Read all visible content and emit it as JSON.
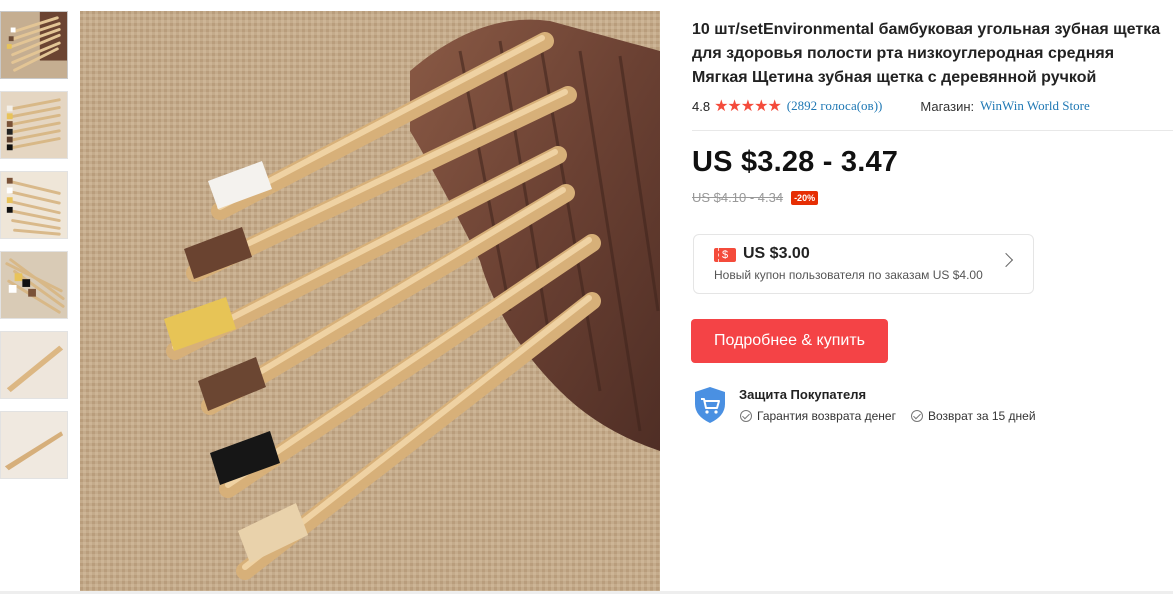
{
  "thumbnails": [
    {
      "name": "thumbnail-1",
      "active": true
    },
    {
      "name": "thumbnail-2"
    },
    {
      "name": "thumbnail-3"
    },
    {
      "name": "thumbnail-4"
    },
    {
      "name": "thumbnail-5"
    },
    {
      "name": "thumbnail-6"
    }
  ],
  "product": {
    "title": "10 шт/setEnvironmental бамбуковая угольная зубная щетка для здоровья полости рта низкоуглеродная средняя Мягкая Щетина зубная щетка с деревянной ручкой",
    "rating": "4.8",
    "stars": "★★★★★",
    "votes": "(2892 голоса(ов))",
    "store_label": "Магазин:",
    "store_name": "WinWin World Store"
  },
  "price": {
    "current": "US $3.28 - 3.47",
    "old": "US $4.10 - 4.34",
    "discount": "-20%"
  },
  "coupon": {
    "icon_text": "$",
    "amount": "US $3.00",
    "description": "Новый купон пользователя по заказам US $4.00"
  },
  "buy_button": {
    "label": "Подробнее & купить"
  },
  "protection": {
    "title": "Защита Покупателя",
    "items": [
      "Гарантия возврата денег",
      "Возврат за 15 дней"
    ]
  },
  "colors": {
    "accent": "#f44346",
    "link": "#1f78b4",
    "stars": "#f44b3b",
    "discount_badge": "#e62e04"
  }
}
